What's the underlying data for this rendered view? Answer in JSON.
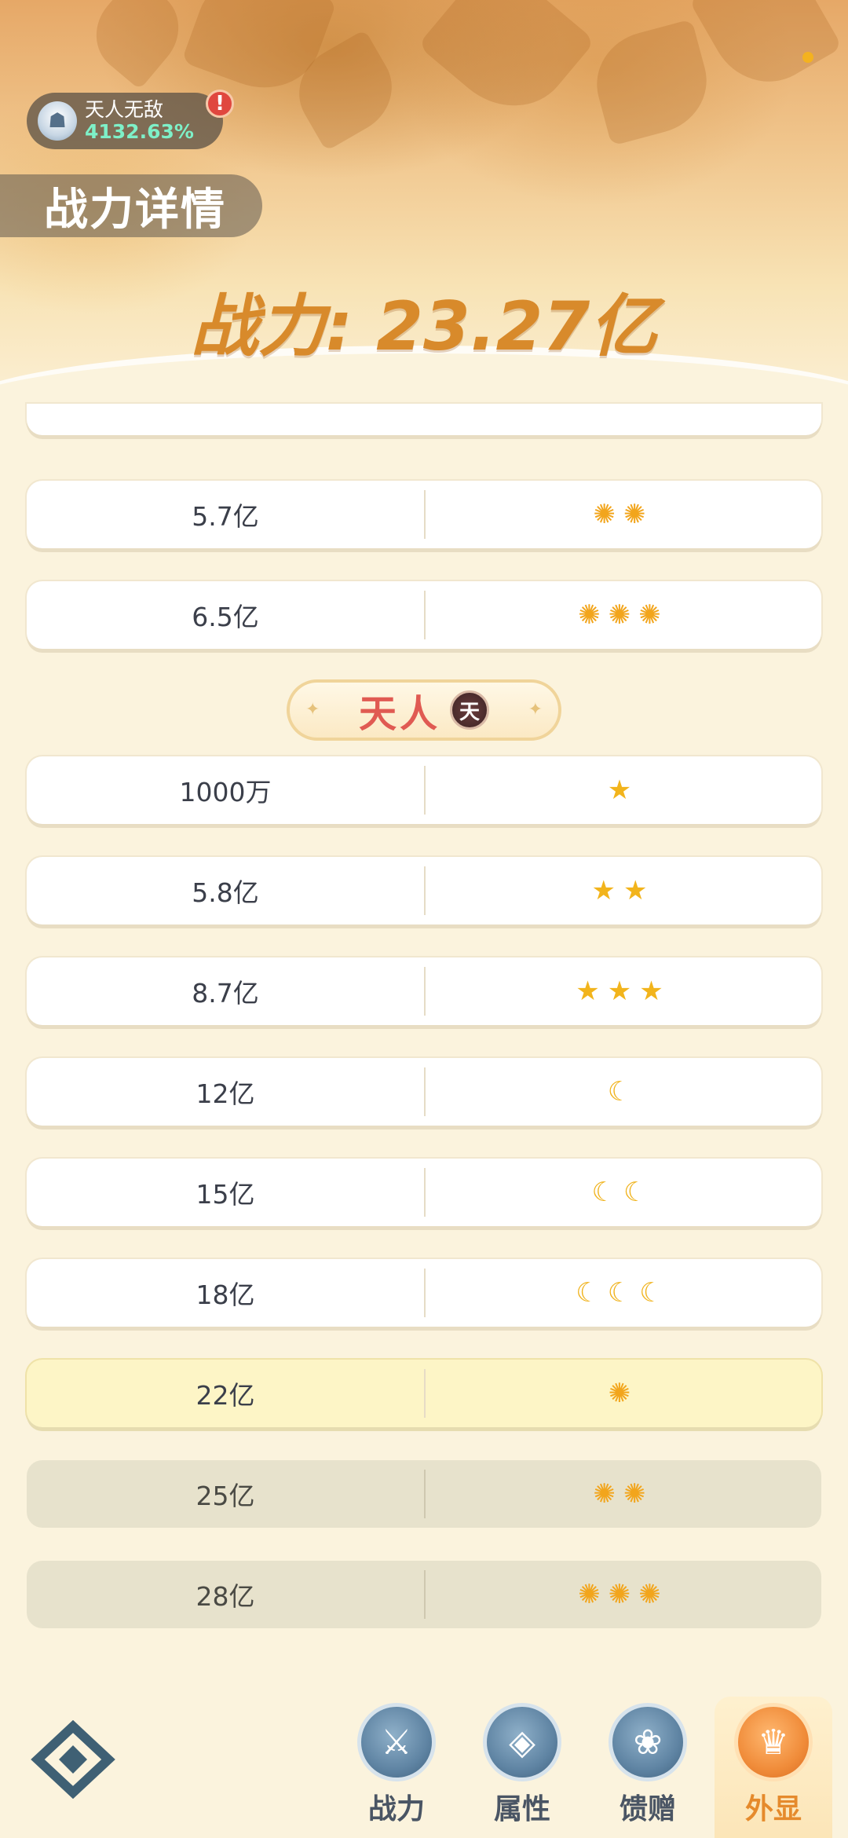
{
  "header": {
    "title_badge": {
      "name": "天人无敌",
      "percent": "4132.63%"
    },
    "alert": "!",
    "section_title": "战力详情",
    "power": "战力: 23.27亿"
  },
  "rows_before": [
    {
      "value": "",
      "icon": "sun",
      "count": 0
    },
    {
      "value": "5.7亿",
      "icon": "sun",
      "count": 2
    },
    {
      "value": "6.5亿",
      "icon": "sun",
      "count": 3
    }
  ],
  "tier": {
    "name": "天人",
    "emblem": "天"
  },
  "rows_after": [
    {
      "value": "1000万",
      "icon": "star",
      "count": 1,
      "state": "done"
    },
    {
      "value": "5.8亿",
      "icon": "star",
      "count": 2,
      "state": "done"
    },
    {
      "value": "8.7亿",
      "icon": "star",
      "count": 3,
      "state": "done"
    },
    {
      "value": "12亿",
      "icon": "moon",
      "count": 1,
      "state": "done"
    },
    {
      "value": "15亿",
      "icon": "moon",
      "count": 2,
      "state": "done"
    },
    {
      "value": "18亿",
      "icon": "moon",
      "count": 3,
      "state": "done"
    },
    {
      "value": "22亿",
      "icon": "sun",
      "count": 1,
      "state": "current"
    },
    {
      "value": "25亿",
      "icon": "sun",
      "count": 2,
      "state": "locked"
    },
    {
      "value": "28亿",
      "icon": "sun",
      "count": 3,
      "state": "locked"
    }
  ],
  "nav": {
    "items": [
      {
        "label": "战力",
        "icon": "swords-icon",
        "glyph": "⚔"
      },
      {
        "label": "属性",
        "icon": "shield-icon",
        "glyph": "◈"
      },
      {
        "label": "馈赠",
        "icon": "gift-icon",
        "glyph": "❀"
      },
      {
        "label": "外显",
        "icon": "crown-icon",
        "glyph": "♛"
      }
    ],
    "active": "外显"
  },
  "colors": {
    "accent": "#d88a2b",
    "sun": "#f2a51c",
    "tier_red": "#e05a52",
    "nav_blue": "#5f84a3"
  }
}
